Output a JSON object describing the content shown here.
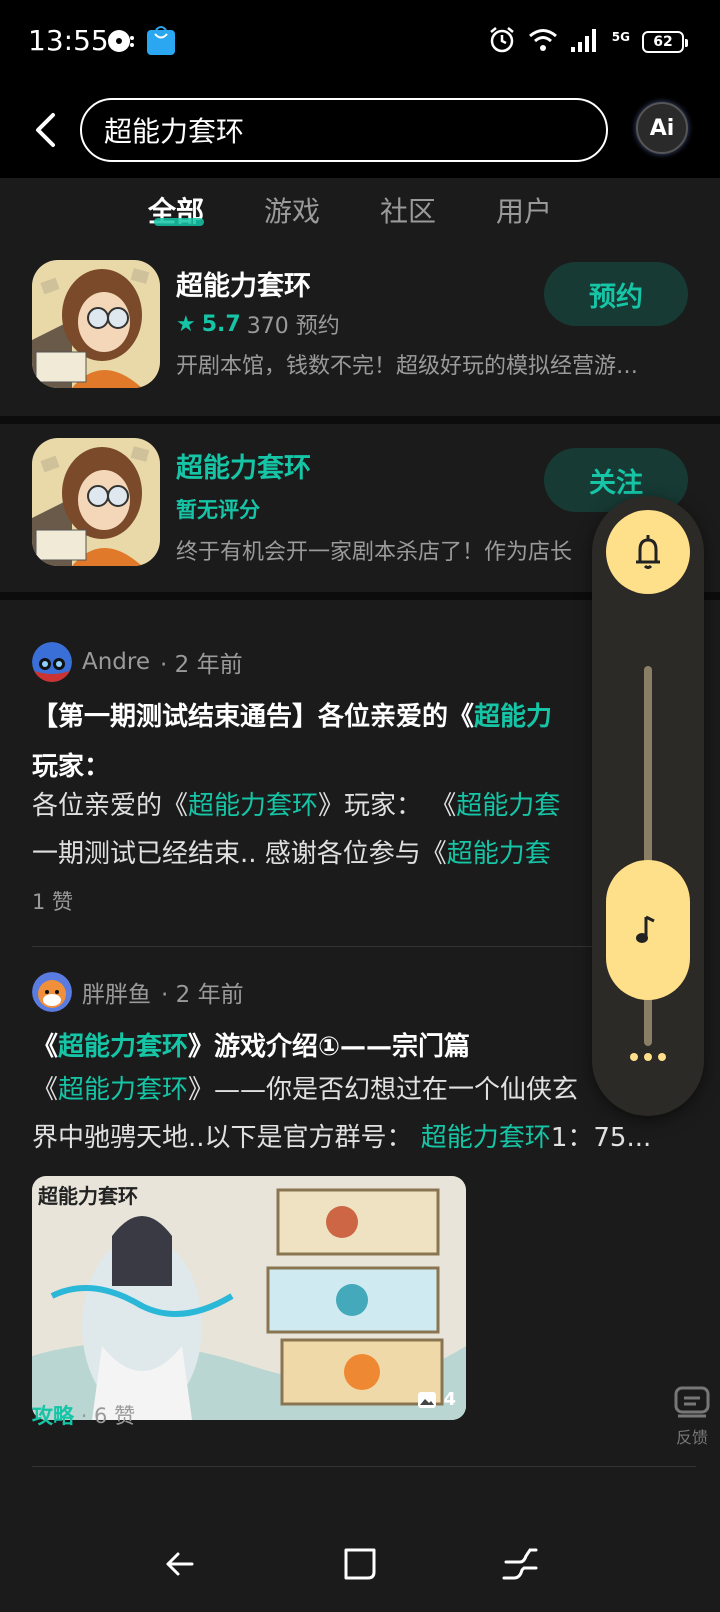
{
  "status_bar": {
    "time": "13:55",
    "network": "5G",
    "battery": "62"
  },
  "search": {
    "query": "超能力套环",
    "ai_label": "Ai"
  },
  "tabs": [
    {
      "label": "全部",
      "active": true
    },
    {
      "label": "游戏",
      "active": false
    },
    {
      "label": "社区",
      "active": false
    },
    {
      "label": "用户",
      "active": false
    }
  ],
  "apps": [
    {
      "title": "超能力套环",
      "rating": "5.7",
      "meta": "370 预约",
      "desc": "开剧本馆，钱数不完！超级好玩的模拟经营游…",
      "button": "预约"
    },
    {
      "title": "超能力套环",
      "rating_text": "暂无评分",
      "desc": "终于有机会开一家剧本杀店了！作为店长",
      "button": "关注"
    }
  ],
  "posts": [
    {
      "author": "Andre",
      "time": "· 2 年前",
      "title_pre": "【第一期测试结束通告】各位亲爱的《",
      "title_hl": "超能力",
      "title_line2": "玩家：",
      "body_l1_a": "各位亲爱的《",
      "body_l1_hl": "超能力套环",
      "body_l1_b": "》玩家：  《",
      "body_l1_hl2": "超能力套",
      "body_l2_a": "一期测试已经结束..  感谢各位参与《",
      "body_l2_hl": "超能力套",
      "likes": "1 赞"
    },
    {
      "author": "胖胖鱼",
      "time": "· 2 年前",
      "title_a": "《",
      "title_hl": "超能力套环",
      "title_b": "》游戏介绍①——宗门篇",
      "body_l1_a": "《",
      "body_l1_hl": "超能力套环",
      "body_l1_b": "》——你是否幻想过在一个仙侠玄",
      "body_l2_a": "界中驰骋天地..以下是官方群号：  ",
      "body_l2_hl": "超能力套环",
      "body_l2_b": "1：75...",
      "image_banner": "超能力套环",
      "image_count": "4",
      "tag": "攻略",
      "likes": "· 6 赞"
    }
  ],
  "feedback_label": "反馈",
  "colors": {
    "accent": "#15c5a6",
    "background": "#1b1b1b",
    "float_yellow": "#fedf8a"
  }
}
